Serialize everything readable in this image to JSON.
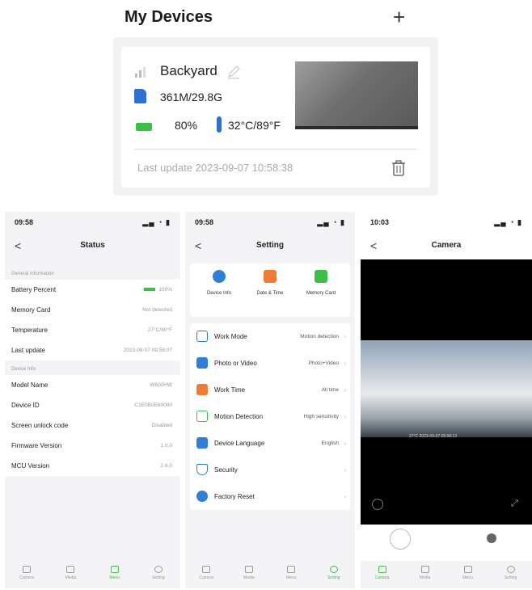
{
  "devices": {
    "title": "My Devices",
    "add_label": "+",
    "card": {
      "name": "Backyard",
      "storage": "361M/29.8G",
      "battery": "80%",
      "temperature": "32°C/89°F",
      "last_update": "Last update 2023-09-07 10:58:38"
    }
  },
  "status": {
    "time": "09:58",
    "indicators": "▂▄ ◔ ▮",
    "title": "Status",
    "back": "<",
    "sections": [
      {
        "header": "General information",
        "rows": [
          {
            "k": "Battery Percent",
            "v": "100%"
          },
          {
            "k": "Memory Card",
            "v": "Not detected"
          },
          {
            "k": "Temperature",
            "v": "27°C/80°F"
          },
          {
            "k": "Last update",
            "v": "2023-09-07 09:58:07"
          }
        ]
      },
      {
        "header": "Device Info",
        "rows": [
          {
            "k": "Model Name",
            "v": "W600HW"
          },
          {
            "k": "Device ID",
            "v": "C1E0B0E60000"
          },
          {
            "k": "Screen unlock code",
            "v": "Disabled"
          },
          {
            "k": "Firmware Version",
            "v": "1.0.0"
          },
          {
            "k": "MCU Version",
            "v": "2.6.0"
          }
        ]
      }
    ]
  },
  "setting": {
    "time": "09:58",
    "indicators": "▂▄ ◔ ▮",
    "title": "Setting",
    "back": "<",
    "quick": [
      {
        "label": "Device Info",
        "color": "#2e7fd8"
      },
      {
        "label": "Date & Time",
        "color": "#f07b33"
      },
      {
        "label": "Memory Card",
        "color": "#3cbf45"
      }
    ],
    "rows": [
      {
        "k": "Work Mode",
        "v": "Motion detection",
        "color": "#2e7fd8"
      },
      {
        "k": "Photo or Video",
        "v": "Photo+Video",
        "color": "#2e7fd8"
      },
      {
        "k": "Work Time",
        "v": "All time",
        "color": "#f07b33"
      },
      {
        "k": "Motion Detection",
        "v": "High sensitivity",
        "color": "#3cbf45"
      },
      {
        "k": "Device Language",
        "v": "English",
        "color": "#2e7fd8"
      },
      {
        "k": "Security",
        "v": "",
        "color": "#2e7fd8"
      },
      {
        "k": "Factory Reset",
        "v": "",
        "color": "#2e7fd8"
      }
    ]
  },
  "camera": {
    "time": "10:03",
    "indicators": "▂▄ ◔ ▮",
    "title": "Camera",
    "back": "<",
    "osd": "27°C  2023-09-07 09:58:13"
  },
  "tabs": [
    "Camera",
    "Media",
    "Menu",
    "Setting"
  ],
  "active_tabs": {
    "status": 2,
    "setting": 3,
    "camera": 0
  }
}
